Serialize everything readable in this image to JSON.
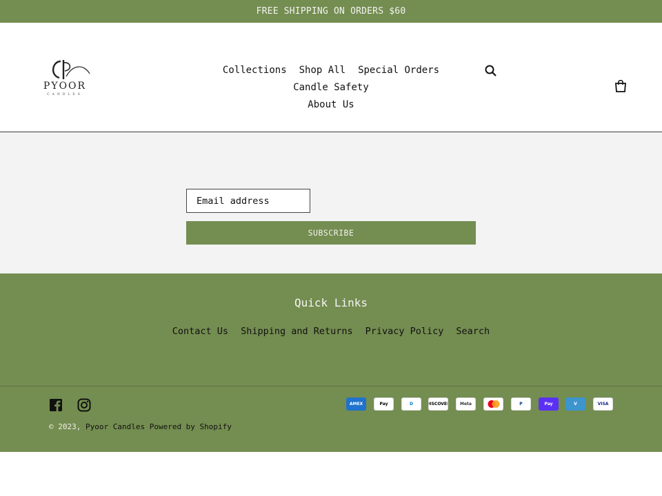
{
  "announcement": "FREE SHIPPING ON ORDERS $60",
  "brand": {
    "name": "PYOOR",
    "sub": "CANDLES",
    "monogram": "P"
  },
  "nav": {
    "items": [
      "Collections",
      "Shop All",
      "Special Orders",
      "Candle Safety",
      "About Us"
    ]
  },
  "icons": {
    "search": "search-icon",
    "cart": "cart-icon",
    "facebook": "facebook-icon",
    "instagram": "instagram-icon"
  },
  "newsletter": {
    "placeholder": "Email address",
    "button": "SUBSCRIBE"
  },
  "footer": {
    "quick_links_title": "Quick Links",
    "links": [
      "Contact Us",
      "Shipping and Returns",
      "Privacy Policy",
      "Search"
    ],
    "copyright_prefix": "© 2023,",
    "store_name": "Pyoor Candles",
    "powered_by": "Powered by Shopify"
  },
  "payments": [
    {
      "name": "American Express",
      "label": "AMEX",
      "bg": "#1f72cd",
      "fg": "#ffffff"
    },
    {
      "name": "Apple Pay",
      "label": "Pay",
      "bg": "#ffffff",
      "fg": "#000000"
    },
    {
      "name": "Diners Club",
      "label": "D",
      "bg": "#ffffff",
      "fg": "#0079be"
    },
    {
      "name": "Discover",
      "label": "DISCOVER",
      "bg": "#ffffff",
      "fg": "#000000"
    },
    {
      "name": "Meta Pay",
      "label": "Meta",
      "bg": "#ffffff",
      "fg": "#333333"
    },
    {
      "name": "Mastercard",
      "label": "",
      "bg": "#ffffff",
      "fg": "#000000"
    },
    {
      "name": "PayPal",
      "label": "P",
      "bg": "#ffffff",
      "fg": "#003087"
    },
    {
      "name": "Shop Pay",
      "label": "Pay",
      "bg": "#5a31f4",
      "fg": "#ffffff"
    },
    {
      "name": "Venmo",
      "label": "V",
      "bg": "#3d95ce",
      "fg": "#ffffff"
    },
    {
      "name": "Visa",
      "label": "VISA",
      "bg": "#ffffff",
      "fg": "#142688"
    }
  ],
  "colors": {
    "brand_green": "#748d51",
    "newsletter_bg": "#f2f3f2"
  }
}
